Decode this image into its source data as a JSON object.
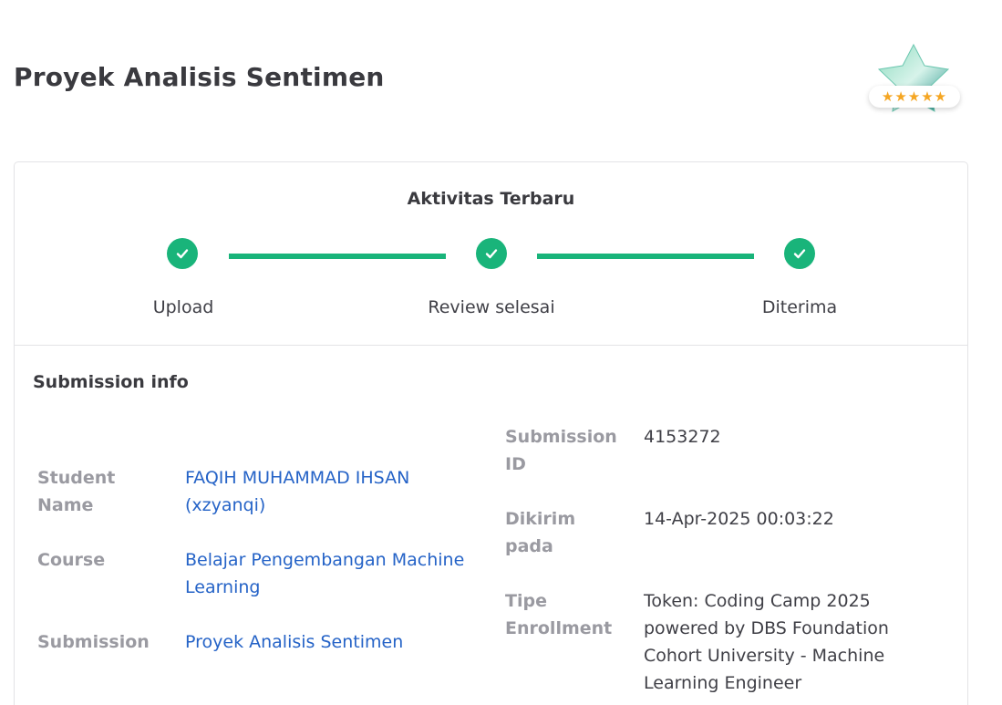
{
  "page": {
    "title": "Proyek Analisis Sentimen",
    "badge_icon": "star-rating-badge",
    "rating_stars": "★★★★★"
  },
  "activity": {
    "title": "Aktivitas Terbaru",
    "steps": [
      {
        "label": "Upload",
        "status": "done",
        "icon": "check-icon"
      },
      {
        "label": "Review selesai",
        "status": "done",
        "icon": "check-icon"
      },
      {
        "label": "Diterima",
        "status": "done",
        "icon": "check-icon"
      }
    ],
    "accent_color": "#19b47a"
  },
  "submission_info": {
    "title": "Submission info",
    "left": {
      "student_name_label": "Student Name",
      "student_name_value": "FAQIH MUHAMMAD IHSAN (xzyanqi)",
      "course_label": "Course",
      "course_value": "Belajar Pengembangan Machine Learning",
      "submission_label": "Submission",
      "submission_value": "Proyek Analisis Sentimen"
    },
    "right": {
      "submission_id_label": "Submission ID",
      "submission_id_value": "4153272",
      "dikirim_label": "Dikirim pada",
      "dikirim_value": "14-Apr-2025 00:03:22",
      "tipe_label": "Tipe Enrollment",
      "tipe_value": "Token: Coding Camp 2025 powered by DBS Foundation Cohort University - Machine Learning Engineer"
    },
    "link_color": "#2563c7"
  }
}
